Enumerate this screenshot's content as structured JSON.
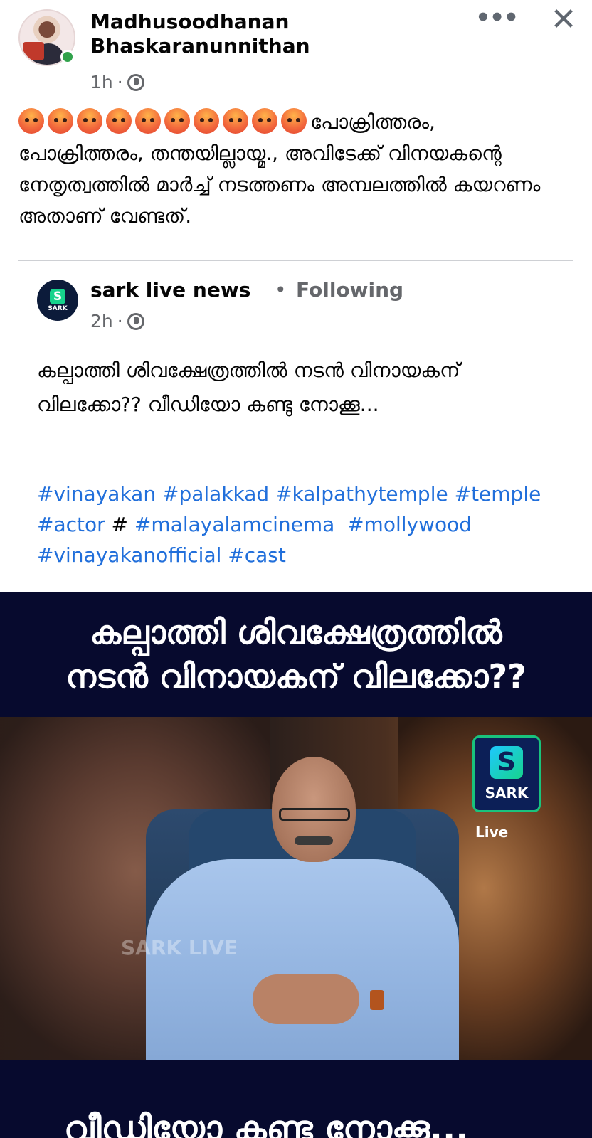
{
  "post": {
    "author": "Madhusoodhanan Bhaskaranunnithan",
    "time": "1h",
    "separator": "·",
    "privacy_icon": "globe-icon",
    "more_icon": "more-options-icon",
    "more_label": "•••",
    "close_icon": "close-icon",
    "close_label": "✕",
    "reaction_emoji": "angry-face-icon",
    "reaction_emoji_count": 10,
    "text_line1": "പോക്രിത്തരം,",
    "text_rest": "പോക്രിത്തരം, തന്തയില്ലായ്മ., അവിടേക്ക് വിനയകന്റെ നേതൃത്വത്തിൽ മാർച്ച് നടത്തണം അമ്പലത്തിൽ കയറണം  അതാണ് വേണ്ടത്."
  },
  "shared": {
    "page_name": "sark live news",
    "dot": "•",
    "following": "Following",
    "time": "2h",
    "separator": "·",
    "avatar_label": "SARK",
    "avatar_mark": "S",
    "text": "കല്പാത്തി ശിവക്ഷേത്രത്തിൽ നടൻ വിനായകന് വിലക്കോ?? വീഡിയോ കണ്ടു നോക്കൂ...",
    "hashtags_line1": [
      "#vinayakan",
      "#palakkad",
      "#kalpathytemple",
      "#temple"
    ],
    "hashtags_line2_tag1": "#actor",
    "hashtags_line2_plain": "#",
    "hashtags_line2_tag2": "#malayalamcinema",
    "hashtags_line2_tag3": "#mollywood",
    "hashtags_line3": [
      "#vinayakanofficial",
      "#cast"
    ]
  },
  "video": {
    "banner_line1": "കല്പാത്തി ശിവക്ഷേത്രത്തിൽ",
    "banner_line2": "നടൻ വിനായകന് വിലക്കോ??",
    "logo_mark": "S",
    "logo_text": "SARK",
    "live_text": "Live",
    "watermark": "SARK LIVE",
    "bottom_text": "വീഡിയോ കണ്ടു നോക്കൂ..."
  }
}
